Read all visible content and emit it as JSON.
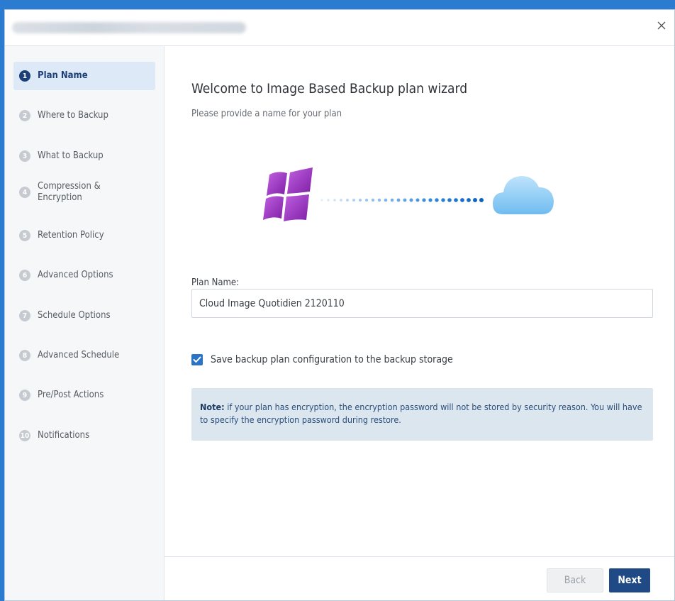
{
  "window": {
    "close_glyph": "X"
  },
  "steps": [
    {
      "num": "1",
      "label": "Plan Name",
      "active": true
    },
    {
      "num": "2",
      "label": "Where to Backup"
    },
    {
      "num": "3",
      "label": "What to Backup"
    },
    {
      "num": "4",
      "label": "Compression &\nEncryption"
    },
    {
      "num": "5",
      "label": "Retention Policy"
    },
    {
      "num": "6",
      "label": "Advanced Options"
    },
    {
      "num": "7",
      "label": "Schedule Options"
    },
    {
      "num": "8",
      "label": "Advanced Schedule"
    },
    {
      "num": "9",
      "label": "Pre/Post Actions"
    },
    {
      "num": "10",
      "label": "Notifications"
    }
  ],
  "main": {
    "heading": "Welcome to Image Based Backup plan wizard",
    "subheading": "Please provide a name for your plan",
    "illustration": {
      "left_icon": "windows-logo-icon",
      "right_icon": "cloud-icon"
    },
    "plan_name_label": "Plan Name:",
    "plan_name_value": "Cloud Image Quotidien 2120110",
    "save_config_label": "Save backup plan configuration to the backup storage",
    "save_config_checked": true,
    "note_bold": "Note:",
    "note_text": " if your plan has encryption, the encryption password will not be stored by security reason. You will have to specify the encryption password during restore."
  },
  "footer": {
    "back_label": "Back",
    "next_label": "Next"
  },
  "colors": {
    "active_step": "#1c3f78",
    "accent_blue": "#2a73c5",
    "next_button": "#1f4a86",
    "note_bg": "#dce6ef",
    "windows_purple": "#a23cc8"
  }
}
